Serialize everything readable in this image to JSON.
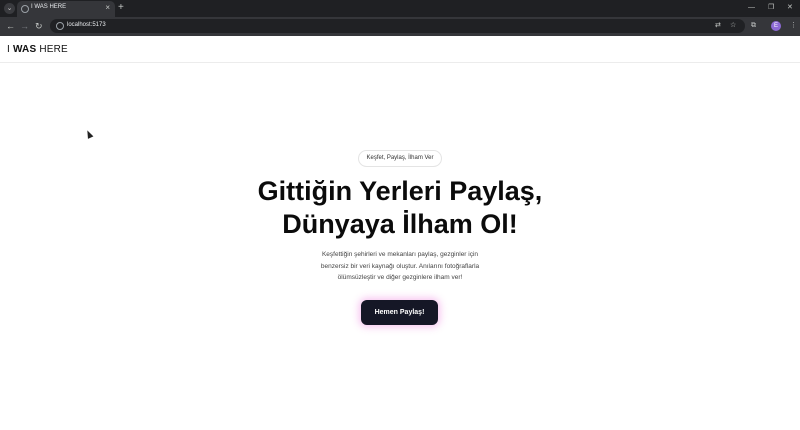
{
  "browser": {
    "tab_title": "I WAS HERE",
    "new_tab": "+",
    "url": "localhost:5173",
    "profile_initial": "E"
  },
  "header": {
    "logo_prefix": "I ",
    "logo_bold": "WAS",
    "logo_suffix": " HERE"
  },
  "hero": {
    "badge": "Keşfet, Paylaş, İlham Ver",
    "title_line1": "Gittiğin Yerleri Paylaş,",
    "title_line2": "Dünyaya İlham Ol!",
    "description_line1": "Keşfettiğin şehirleri ve mekanları paylaş, gezginler için",
    "description_line2": "benzersiz bir veri kaynağı oluştur. Anılarını fotoğraflarla",
    "description_line3": "ölümsüzleştir ve diğer gezginlere ilham ver!",
    "cta_label": "Hemen Paylaş!"
  },
  "colors": {
    "cta_background": "#151726",
    "cta_glow": "#ec78dc",
    "text": "#0b0b0b"
  }
}
